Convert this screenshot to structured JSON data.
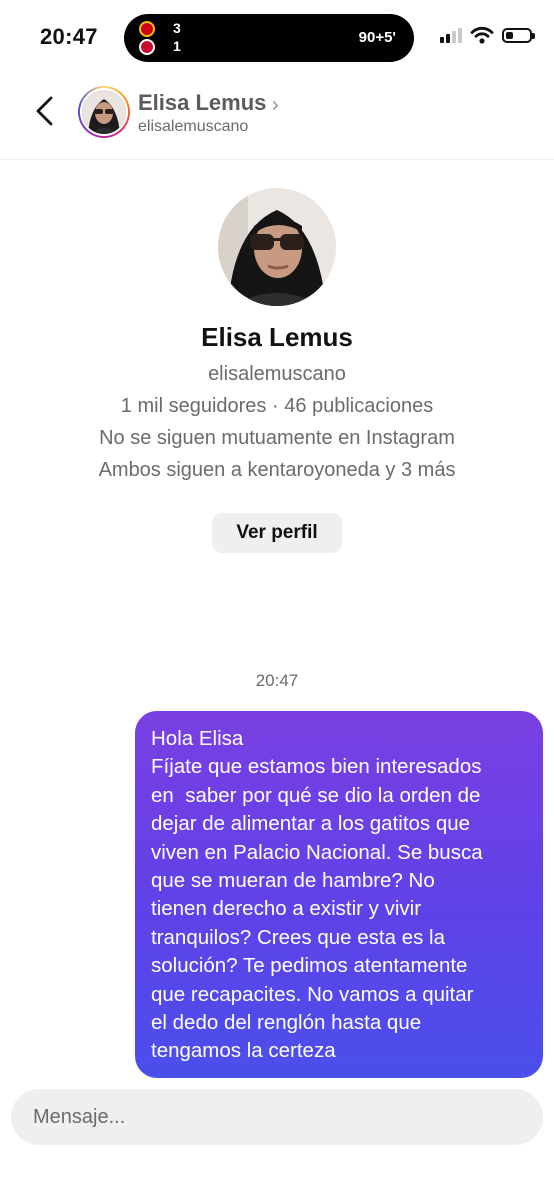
{
  "status_bar": {
    "time": "20:47",
    "live_activity": {
      "team_a_score": "3",
      "team_b_score": "1",
      "match_time": "90+5'"
    },
    "battery_level": 0.3
  },
  "header": {
    "name": "Elisa Lemus",
    "chevron": "›",
    "username": "elisalemuscano"
  },
  "profile": {
    "name": "Elisa Lemus",
    "username": "elisalemuscano",
    "stats": "1 mil seguidores · 46 publicaciones",
    "mutual_status": "No se siguen mutuamente en Instagram",
    "mutual_followers": "Ambos siguen a kentaroyoneda y 3 más",
    "view_profile_label": "Ver perfil"
  },
  "conversation": {
    "timestamp": "20:47",
    "messages": [
      {
        "from": "me",
        "text": "Hola Elisa\nFíjate que estamos bien interesados\nen  saber por qué se dio la orden de\ndejar de alimentar a los gatitos que\nviven en Palacio Nacional. Se busca\nque se mueran de hambre? No\ntienen derecho a existir y vivir\ntranquilos? Crees que esta es la\nsolución? Te pedimos atentamente\nque recapacites. No vamos a quitar\nel dedo del renglón hasta que\ntengamos la certeza"
      }
    ]
  },
  "composer": {
    "placeholder": "Mensaje..."
  },
  "icons": {
    "back": "back-arrow-icon",
    "signal": "cellular-signal-icon",
    "wifi": "wifi-icon",
    "battery": "battery-icon"
  },
  "colors": {
    "bubble_gradient_top": "#7a3fe2",
    "bubble_gradient_bottom": "#4b4fec",
    "secondary_text": "#6b6b6b"
  }
}
